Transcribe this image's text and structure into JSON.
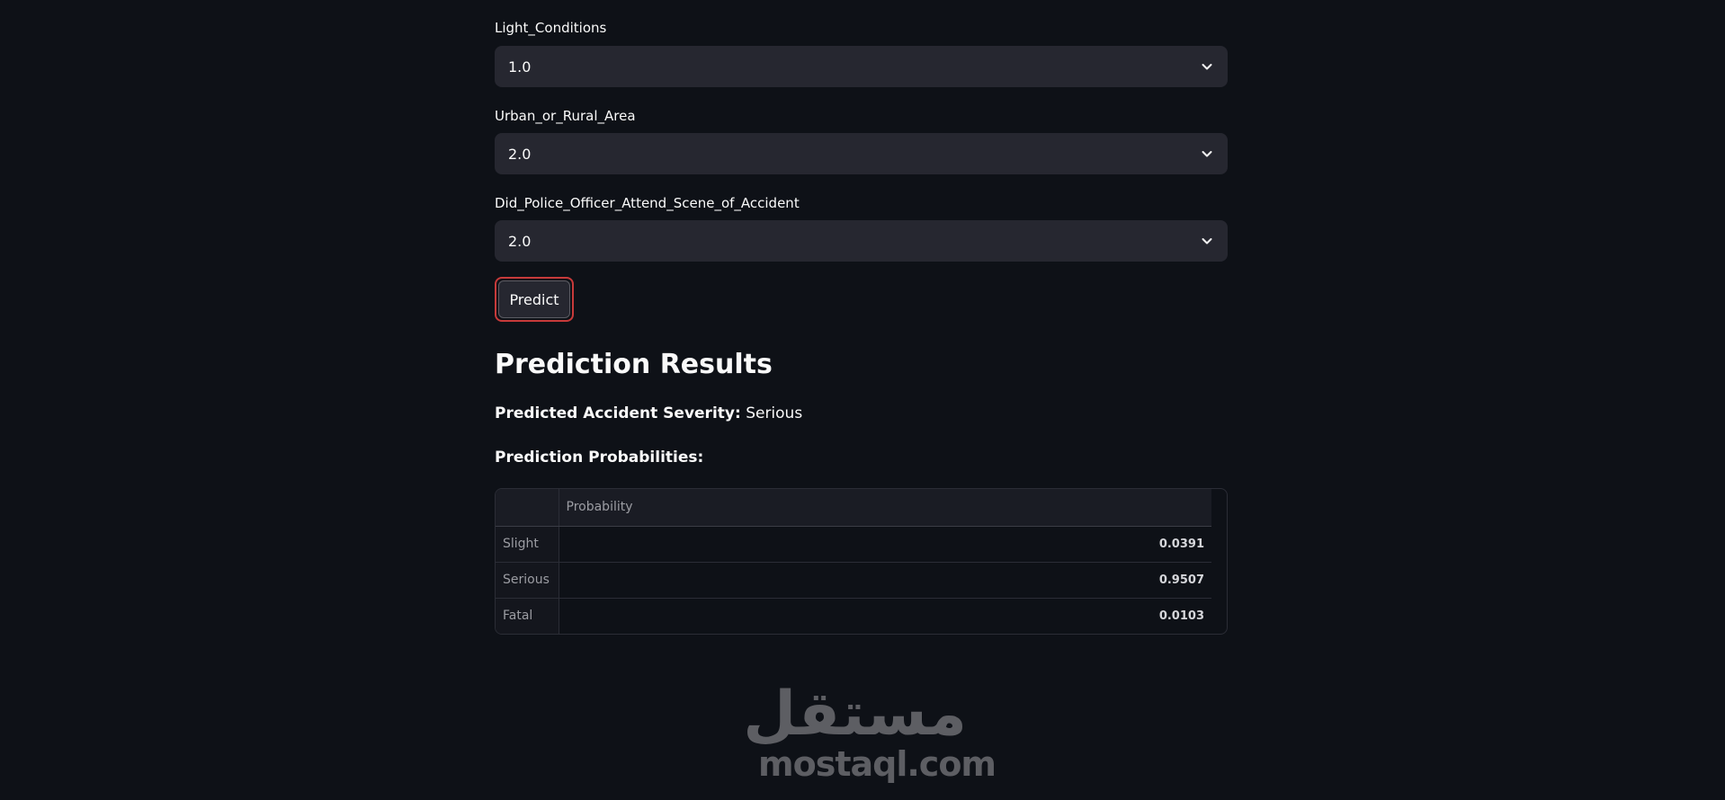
{
  "form": {
    "fields": [
      {
        "label": "Light_Conditions",
        "value": "1.0",
        "icon": "chevron-down-icon"
      },
      {
        "label": "Urban_or_Rural_Area",
        "value": "2.0",
        "icon": "chevron-down-icon"
      },
      {
        "label": "Did_Police_Officer_Attend_Scene_of_Accident",
        "value": "2.0",
        "icon": "chevron-down-icon"
      }
    ],
    "predict_label": "Predict"
  },
  "results": {
    "title": "Prediction Results",
    "severity_label": "Predicted Accident Severity:",
    "severity_value": "Serious",
    "probabilities_label": "Prediction Probabilities:",
    "table": {
      "columns": [
        "",
        "Probability"
      ],
      "rows": [
        {
          "label": "Slight",
          "value": "0.0391"
        },
        {
          "label": "Serious",
          "value": "0.9507"
        },
        {
          "label": "Fatal",
          "value": "0.0103"
        }
      ]
    }
  },
  "watermark": {
    "arabic": "مستقل",
    "latin": "mostaql.com"
  },
  "colors": {
    "background": "#0e1117",
    "input_bg": "#262730",
    "button_focus_border": "#c73a3a"
  }
}
